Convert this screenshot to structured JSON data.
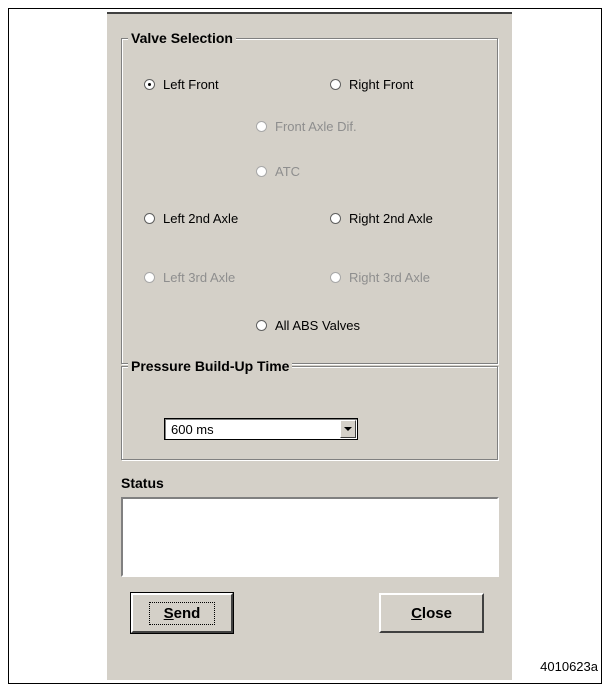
{
  "valve_selection": {
    "title": "Valve Selection",
    "options": {
      "left_front": "Left Front",
      "right_front": "Right Front",
      "front_axle_dif": "Front Axle Dif.",
      "atc": "ATC",
      "left_2nd_axle": "Left 2nd Axle",
      "right_2nd_axle": "Right 2nd Axle",
      "left_3rd_axle": "Left 3rd Axle",
      "right_3rd_axle": "Right 3rd Axle",
      "all_abs": "All ABS Valves"
    },
    "selected": "Left Front"
  },
  "pressure": {
    "title": "Pressure Build-Up Time",
    "selected_value": "600 ms"
  },
  "status": {
    "label": "Status",
    "text": ""
  },
  "buttons": {
    "send_mnemonic": "S",
    "send_rest": "end",
    "close_mnemonic": "C",
    "close_rest": "lose"
  },
  "figure_id": "4010623a"
}
